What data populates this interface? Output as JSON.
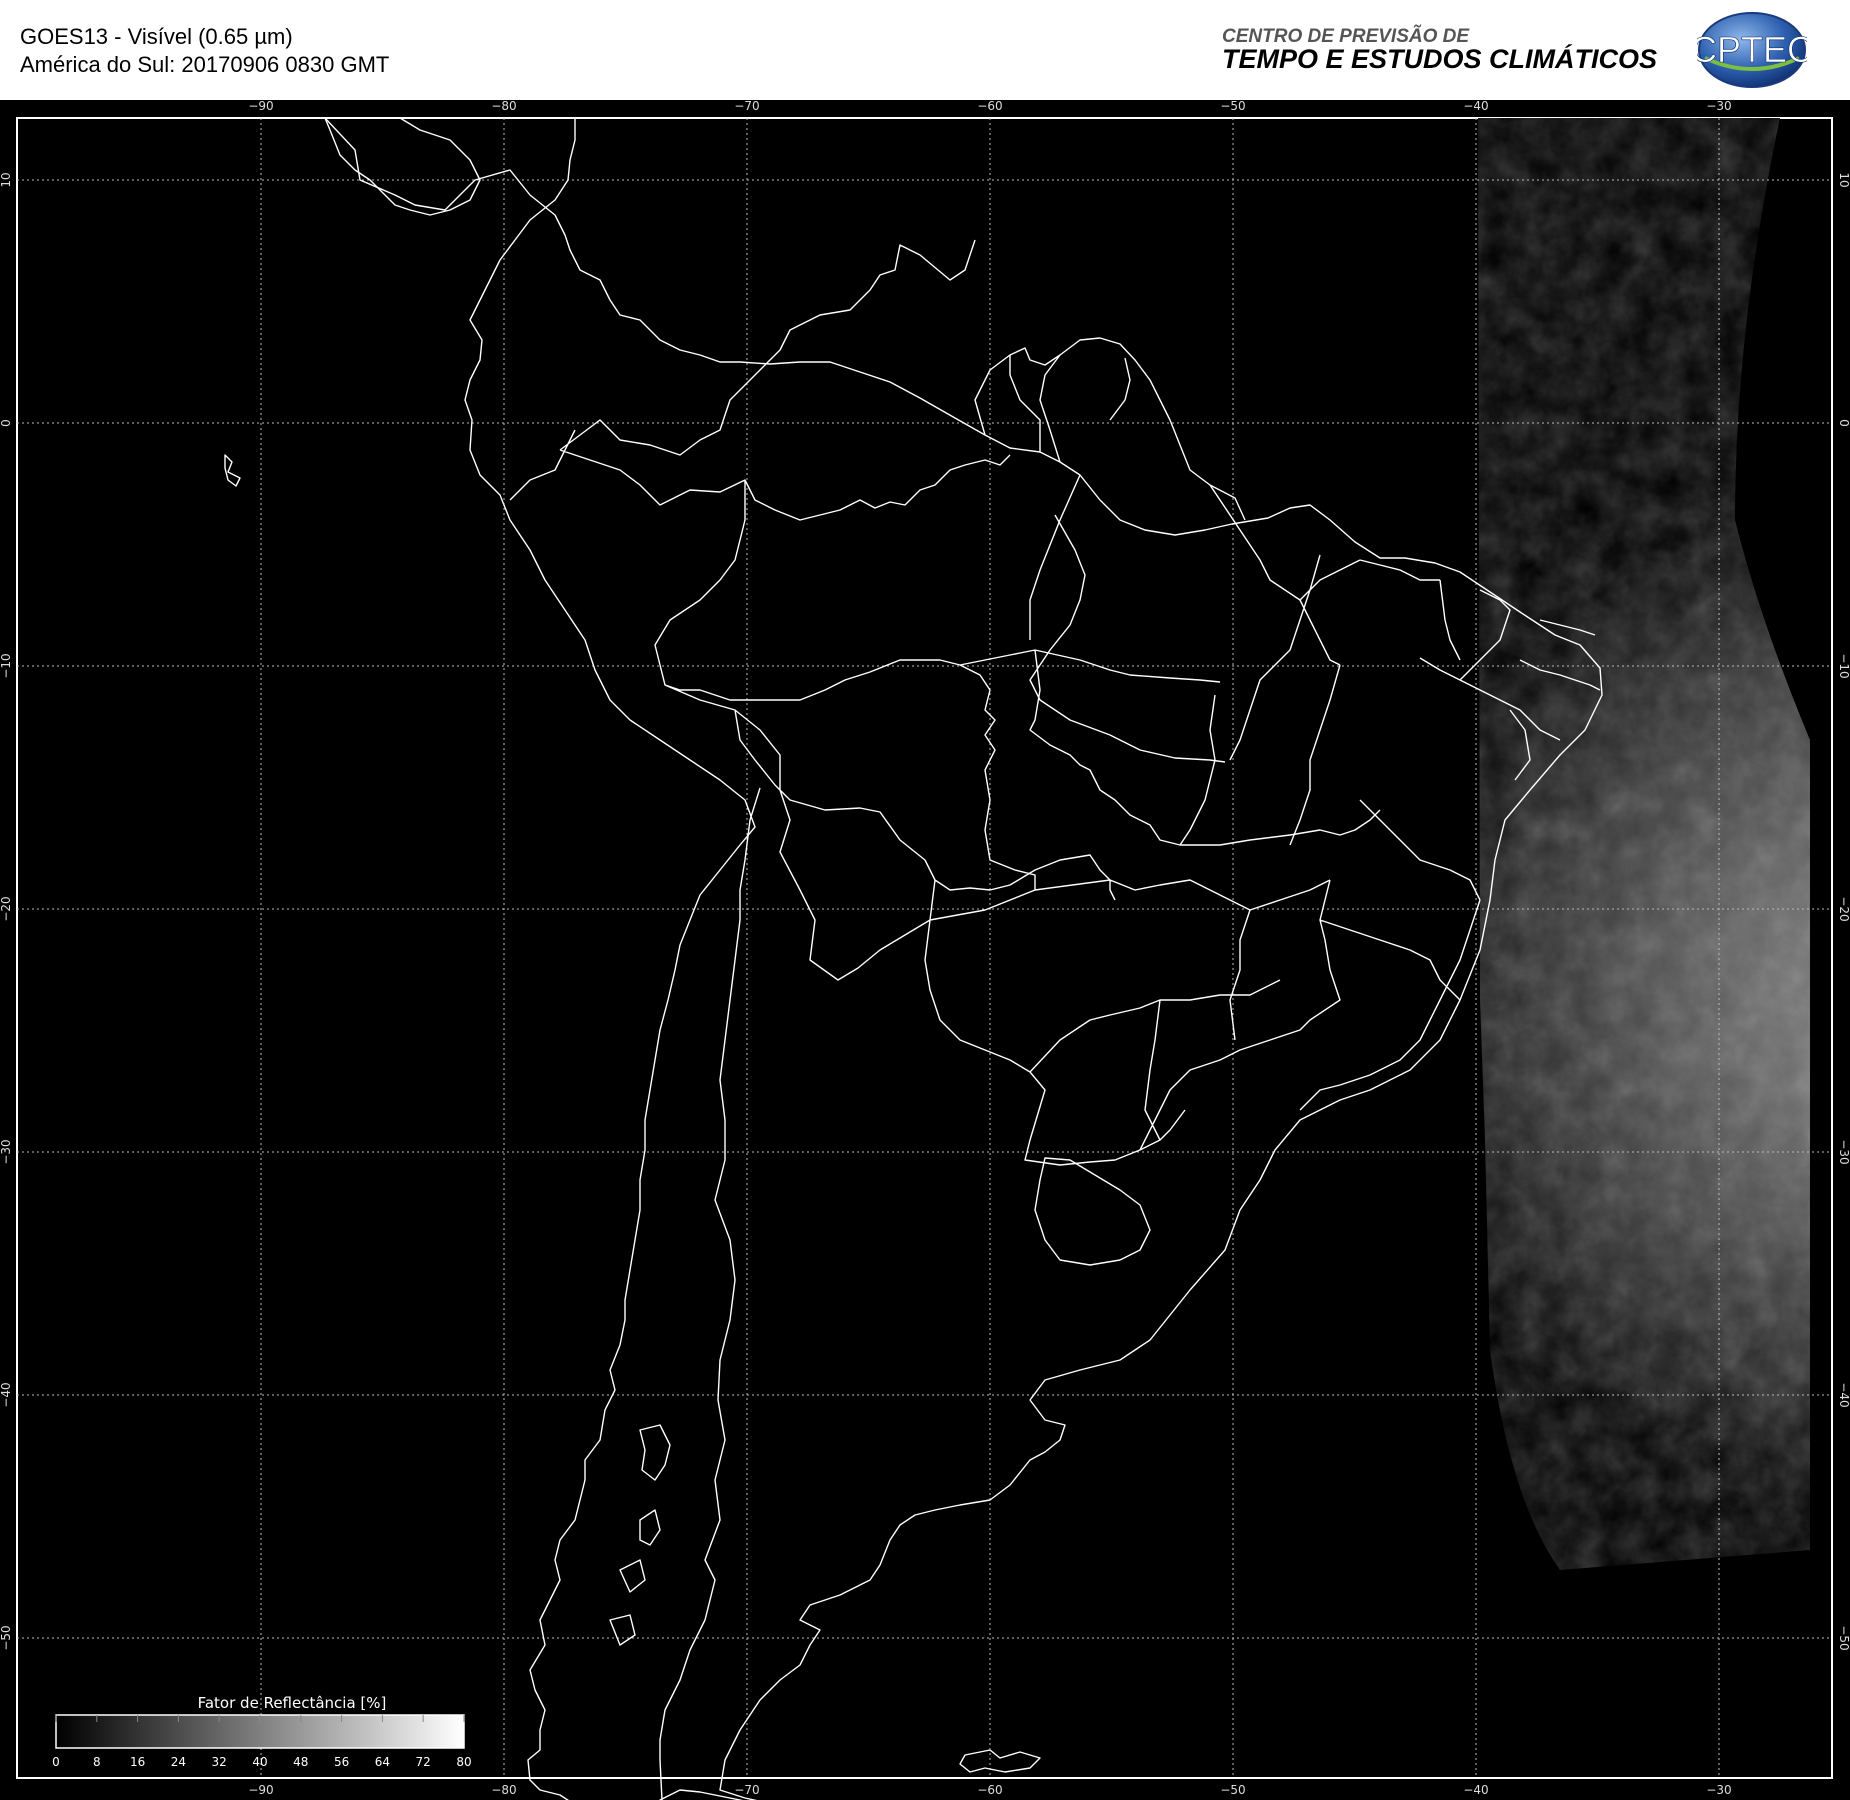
{
  "header": {
    "title_line1": "GOES13 - Visível (0.65 µm)",
    "title_line2": "América do Sul: 20170906 0830 GMT",
    "org_line1": "CENTRO DE PREVISÃO DE",
    "org_line2": "TEMPO E ESTUDOS CLIMÁTICOS",
    "logo_text": "CPTEC"
  },
  "map": {
    "lon_ticks": [
      "−90",
      "−80",
      "−70",
      "−60",
      "−50",
      "−40",
      "−30"
    ],
    "lat_ticks": [
      "10",
      "0",
      "−10",
      "−20",
      "−30",
      "−40",
      "−50"
    ],
    "background_color": "#000000",
    "line_color": "#ffffff"
  },
  "legend": {
    "title": "Fator de Reflectância [%]",
    "ticks": [
      "0",
      "8",
      "16",
      "24",
      "32",
      "40",
      "48",
      "56",
      "64",
      "72",
      "80"
    ]
  }
}
